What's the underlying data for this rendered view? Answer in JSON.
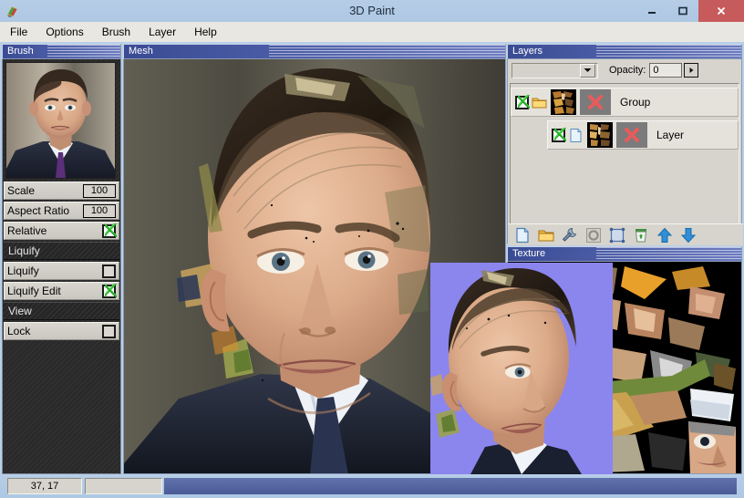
{
  "window": {
    "title": "3D Paint",
    "logo_icon": "paint-app-icon",
    "minimize_label": "Minimize",
    "maximize_label": "Maximize",
    "close_label": "Close"
  },
  "menubar": {
    "items": [
      {
        "label": "File"
      },
      {
        "label": "Options"
      },
      {
        "label": "Brush"
      },
      {
        "label": "Layer"
      },
      {
        "label": "Help"
      }
    ]
  },
  "brush_panel": {
    "title": "Brush",
    "preview_name": "brush-source-portrait",
    "rows": [
      {
        "type": "value",
        "label": "Scale",
        "value": "100"
      },
      {
        "type": "value",
        "label": "Aspect Ratio",
        "value": "100"
      },
      {
        "type": "check",
        "label": "Relative",
        "checked": true
      },
      {
        "type": "section",
        "label": "Liquify"
      },
      {
        "type": "check",
        "label": "Liquify",
        "checked": false
      },
      {
        "type": "check",
        "label": "Liquify Edit",
        "checked": true
      },
      {
        "type": "section",
        "label": "View"
      },
      {
        "type": "check",
        "label": "Lock",
        "checked": false
      }
    ]
  },
  "mesh_panel": {
    "title": "Mesh",
    "viewport_name": "3d-mesh-viewport"
  },
  "layers_panel": {
    "title": "Layers",
    "blend_mode": "",
    "opacity_label": "Opacity:",
    "opacity_value": "0",
    "rows": [
      {
        "name": "Group",
        "visible": true,
        "kind_icon": "folder-icon",
        "indent": false
      },
      {
        "name": "Layer",
        "visible": true,
        "kind_icon": "document-icon",
        "indent": true
      }
    ],
    "tools": [
      {
        "icon": "new-document-icon",
        "label": "New"
      },
      {
        "icon": "open-folder-icon",
        "label": "Open"
      },
      {
        "icon": "wrench-icon",
        "label": "Properties"
      },
      {
        "icon": "circle-icon",
        "label": "Mask"
      },
      {
        "icon": "selection-box-icon",
        "label": "Transform"
      },
      {
        "icon": "trash-icon",
        "label": "Delete"
      },
      {
        "icon": "arrow-up-icon",
        "label": "Move Up"
      },
      {
        "icon": "arrow-down-icon",
        "label": "Move Down"
      }
    ]
  },
  "texture_panel": {
    "title": "Texture",
    "atlas_name": "texture-atlas-uv"
  },
  "floating_preview": {
    "name": "texture-preview-overlay",
    "background_color": "#8b85ee"
  },
  "statusbar": {
    "coordinates": "37, 17",
    "secondary": ""
  },
  "colors": {
    "titlebar": "#b6cde6",
    "close_button": "#c75b5b",
    "panel_header_start": "#3a4b94",
    "panel_header_end": "#6c7cc0",
    "panel_face": "#d6d4cd",
    "dark_panel": "#2a2a2a",
    "check_green": "#3fd83f"
  }
}
